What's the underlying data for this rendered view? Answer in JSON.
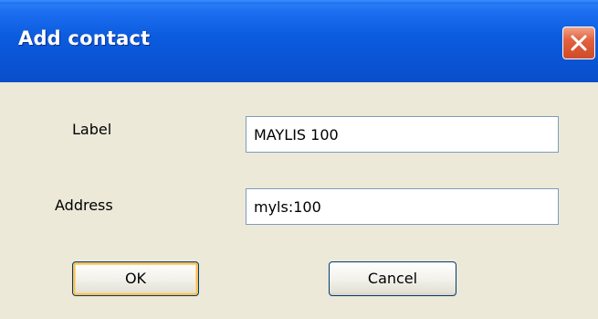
{
  "window": {
    "title": "Add contact"
  },
  "form": {
    "label_field": {
      "label": "Label",
      "value": "MAYLIS 100"
    },
    "address_field": {
      "label": "Address",
      "value": "myls:100"
    }
  },
  "buttons": {
    "ok_label": "OK",
    "cancel_label": "Cancel"
  },
  "icons": {
    "close": "close-icon"
  },
  "colors": {
    "title_bar": "#0a55d6",
    "dialog_background": "#ece9d8",
    "close_button": "#e2623f",
    "default_button_highlight": "#f4c15c"
  }
}
